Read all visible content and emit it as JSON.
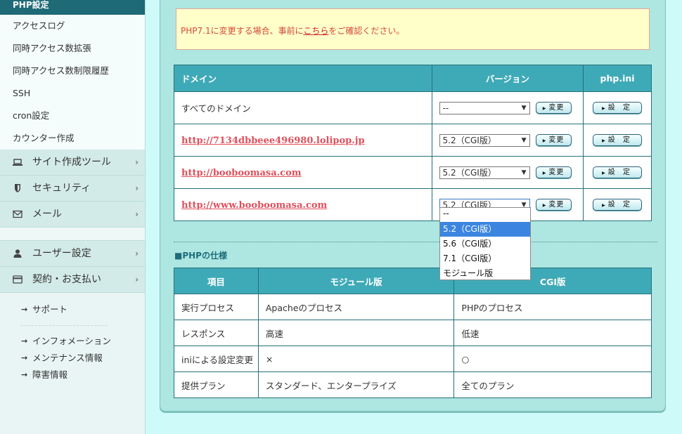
{
  "sidebar": {
    "active": "PHP設定",
    "sub_items": [
      "アクセスログ",
      "同時アクセス数拡張",
      "同時アクセス数制限履歴",
      "SSH",
      "cron設定",
      "カウンター作成"
    ],
    "categories_top": [
      {
        "label": "サイト作成ツール",
        "icon": "laptop-icon"
      },
      {
        "label": "セキュリティ",
        "icon": "shield-icon"
      },
      {
        "label": "メール",
        "icon": "mail-icon"
      }
    ],
    "categories_bottom": [
      {
        "label": "ユーザー設定",
        "icon": "user-icon"
      },
      {
        "label": "契約・お支払い",
        "icon": "credit-card-icon"
      }
    ],
    "links": [
      "サポート",
      "インフォメーション",
      "メンテナンス情報",
      "障害情報"
    ]
  },
  "notice": {
    "before": "PHP7.1に変更する場合、事前に",
    "link": "こちら",
    "after": "をご確認ください。"
  },
  "domain_table": {
    "headers": [
      "ドメイン",
      "バージョン",
      "php.ini"
    ],
    "rows": [
      {
        "domain": "すべてのドメイン",
        "is_link": false,
        "version": "--"
      },
      {
        "domain": "http://7134dbbeee496980.lolipop.jp",
        "is_link": true,
        "version": "5.2（CGI版）"
      },
      {
        "domain": "http://booboomasa.com",
        "is_link": true,
        "version": "5.2（CGI版）"
      },
      {
        "domain": "http://www.booboomasa.com",
        "is_link": true,
        "version": "5.2（CGI版）"
      }
    ],
    "change_button": "変更",
    "settings_button": "設 定"
  },
  "dropdown": {
    "options": [
      "--",
      "5.2（CGI版）",
      "5.6（CGI版）",
      "7.1（CGI版）",
      "モジュール版"
    ],
    "highlighted": "5.2（CGI版）"
  },
  "spec": {
    "heading": "■PHPの仕様",
    "headers": [
      "項目",
      "モジュール版",
      "CGI版"
    ],
    "rows": [
      [
        "実行プロセス",
        "Apacheのプロセス",
        "PHPのプロセス"
      ],
      [
        "レスポンス",
        "高速",
        "低速"
      ],
      [
        "iniによる設定変更",
        "×",
        "○"
      ],
      [
        "提供プラン",
        "スタンダード、エンタープライズ",
        "全てのプラン"
      ]
    ]
  }
}
